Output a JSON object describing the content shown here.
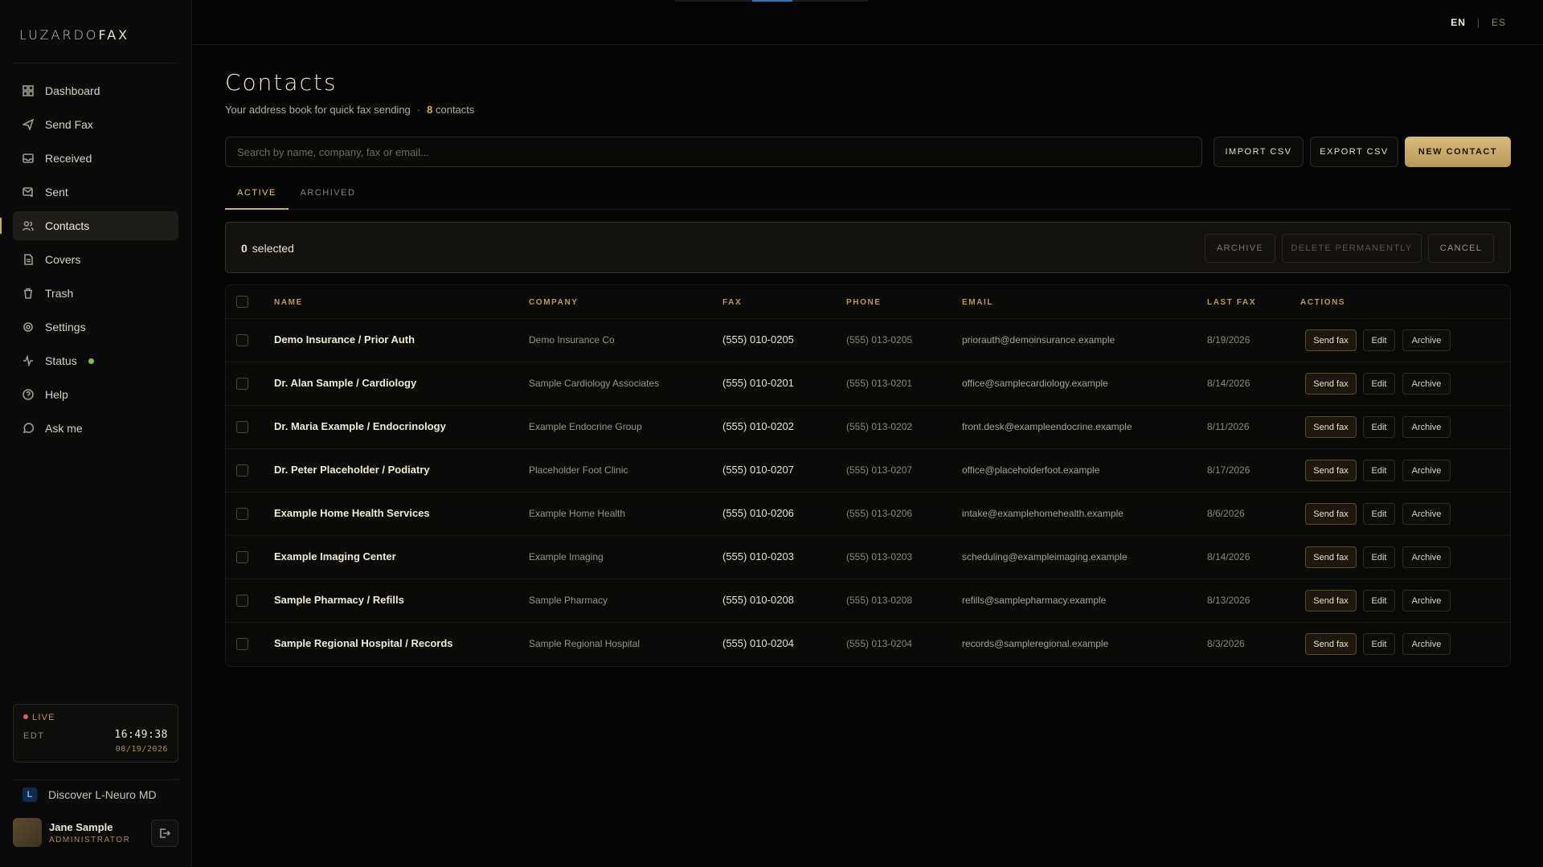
{
  "brand": {
    "part1": "LUZARDO",
    "part2": "FAX"
  },
  "sidebar": {
    "items": [
      {
        "label": "Dashboard",
        "icon": "grid-icon"
      },
      {
        "label": "Send Fax",
        "icon": "send-icon"
      },
      {
        "label": "Received",
        "icon": "inbox-icon"
      },
      {
        "label": "Sent",
        "icon": "mail-sent-icon"
      },
      {
        "label": "Contacts",
        "icon": "users-icon",
        "active": true
      },
      {
        "label": "Covers",
        "icon": "document-icon"
      },
      {
        "label": "Trash",
        "icon": "trash-icon"
      },
      {
        "label": "Settings",
        "icon": "gear-icon"
      },
      {
        "label": "Status",
        "icon": "activity-icon"
      },
      {
        "label": "Help",
        "icon": "help-icon"
      },
      {
        "label": "Ask me",
        "icon": "chat-icon"
      }
    ],
    "live": {
      "label": "LIVE",
      "tz": "EDT",
      "time": "16:49:38",
      "date": "08/19/2026"
    },
    "discover": "Discover L-Neuro MD",
    "user": {
      "name": "Jane Sample",
      "role": "ADMINISTRATOR"
    }
  },
  "topbar": {
    "lang_en": "EN",
    "lang_sep": "|",
    "lang_es": "ES"
  },
  "page": {
    "title": "Contacts",
    "subtitle": "Your address book for quick fax sending",
    "dot": "·",
    "count": "8",
    "count_label": "contacts"
  },
  "search": {
    "placeholder": "Search by name, company, fax or email..."
  },
  "buttons": {
    "import": "IMPORT CSV",
    "export": "EXPORT CSV",
    "new": "NEW CONTACT"
  },
  "tabs": {
    "active": "ACTIVE",
    "archived": "ARCHIVED"
  },
  "selection": {
    "count": "0",
    "label": "selected",
    "archive": "ARCHIVE",
    "delete": "DELETE PERMANENTLY",
    "cancel": "CANCEL"
  },
  "table": {
    "headers": {
      "name": "NAME",
      "company": "COMPANY",
      "fax": "FAX",
      "phone": "PHONE",
      "email": "EMAIL",
      "last_fax": "LAST FAX",
      "actions": "ACTIONS"
    },
    "action_labels": {
      "send": "Send fax",
      "edit": "Edit",
      "archive": "Archive"
    },
    "rows": [
      {
        "name": "Demo Insurance / Prior Auth",
        "company": "Demo Insurance Co",
        "fax": "(555) 010-0205",
        "phone": "(555) 013-0205",
        "email": "priorauth@demoinsurance.example",
        "last_fax": "8/19/2026"
      },
      {
        "name": "Dr. Alan Sample / Cardiology",
        "company": "Sample Cardiology Associates",
        "fax": "(555) 010-0201",
        "phone": "(555) 013-0201",
        "email": "office@samplecardiology.example",
        "last_fax": "8/14/2026"
      },
      {
        "name": "Dr. Maria Example / Endocrinology",
        "company": "Example Endocrine Group",
        "fax": "(555) 010-0202",
        "phone": "(555) 013-0202",
        "email": "front.desk@exampleendocrine.example",
        "last_fax": "8/11/2026"
      },
      {
        "name": "Dr. Peter Placeholder / Podiatry",
        "company": "Placeholder Foot Clinic",
        "fax": "(555) 010-0207",
        "phone": "(555) 013-0207",
        "email": "office@placeholderfoot.example",
        "last_fax": "8/17/2026"
      },
      {
        "name": "Example Home Health Services",
        "company": "Example Home Health",
        "fax": "(555) 010-0206",
        "phone": "(555) 013-0206",
        "email": "intake@examplehomehealth.example",
        "last_fax": "8/6/2026"
      },
      {
        "name": "Example Imaging Center",
        "company": "Example Imaging",
        "fax": "(555) 010-0203",
        "phone": "(555) 013-0203",
        "email": "scheduling@exampleimaging.example",
        "last_fax": "8/14/2026"
      },
      {
        "name": "Sample Pharmacy / Refills",
        "company": "Sample Pharmacy",
        "fax": "(555) 010-0208",
        "phone": "(555) 013-0208",
        "email": "refills@samplepharmacy.example",
        "last_fax": "8/13/2026"
      },
      {
        "name": "Sample Regional Hospital / Records",
        "company": "Sample Regional Hospital",
        "fax": "(555) 010-0204",
        "phone": "(555) 013-0204",
        "email": "records@sampleregional.example",
        "last_fax": "8/3/2026"
      }
    ]
  },
  "colors": {
    "accent": "#c9ad6a",
    "background": "#050505",
    "status_ok": "#7bc24a",
    "live": "#d95f5f"
  }
}
